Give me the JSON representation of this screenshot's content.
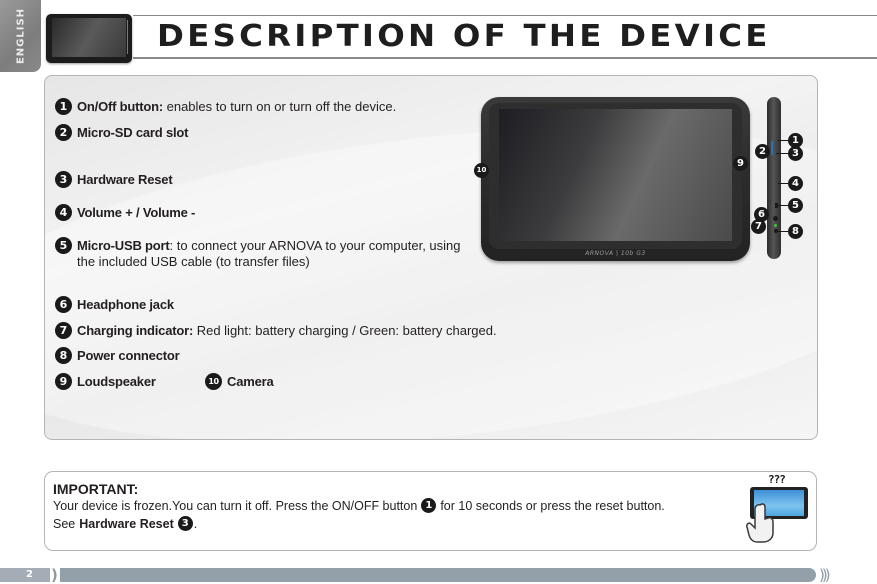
{
  "sidebar": {
    "language_tab": "ENGLISH"
  },
  "header": {
    "title": "DESCRIPTION OF THE DEVICE"
  },
  "features": [
    {
      "number": "1",
      "label": "On/Off button:",
      "description": " enables to turn on or turn off the device."
    },
    {
      "number": "2",
      "label": "Micro-SD card slot",
      "description": ""
    },
    {
      "number": "3",
      "label": "Hardware Reset",
      "description": ""
    },
    {
      "number": "4",
      "label": "Volume + / Volume -",
      "description": ""
    },
    {
      "number": "5",
      "label": "Micro-USB port",
      "description": ": to connect your ARNOVA to your computer, using the included USB cable (to transfer files)"
    },
    {
      "number": "6",
      "label": "Headphone jack",
      "description": ""
    },
    {
      "number": "7",
      "label": "Charging indicator:",
      "description": " Red light: battery charging / Green: battery charged."
    },
    {
      "number": "8",
      "label": "Power connector",
      "description": ""
    },
    {
      "number": "9",
      "label": "Loudspeaker",
      "description": ""
    },
    {
      "number": "10",
      "label": "Camera",
      "description": ""
    }
  ],
  "illustration": {
    "brand_text": "ARNOVA | 10b G3",
    "callouts": [
      "1",
      "2",
      "3",
      "4",
      "5",
      "6",
      "7",
      "8",
      "9",
      "10"
    ]
  },
  "important": {
    "title": "IMPORTANT:",
    "line1_before": "Your device is frozen.You can turn it off. Press the ON/OFF button",
    "line1_ref": "1",
    "line1_after": "for 10 seconds or press the reset button.",
    "line2_before": "See",
    "line2_bold": "Hardware Reset",
    "line2_ref": "3",
    "line2_after": ".",
    "help_glyph": "???"
  },
  "footer": {
    "page_number": "2",
    "end_mark": ")))"
  }
}
